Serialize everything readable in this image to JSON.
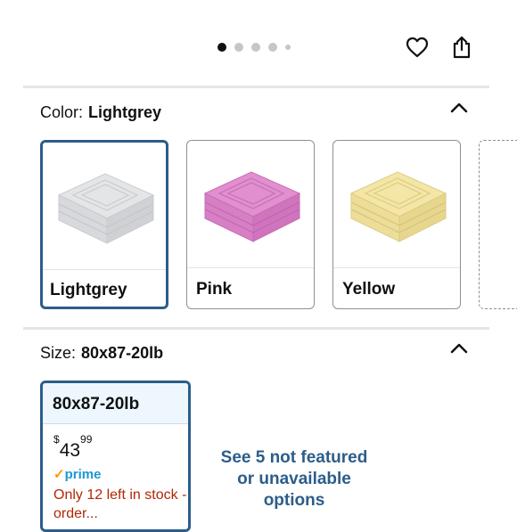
{
  "carousel": {
    "dot_count": 5,
    "active_index": 0
  },
  "header_icons": {
    "favorite": "heart-icon",
    "share": "share-icon"
  },
  "color": {
    "label": "Color:",
    "value": "Lightgrey",
    "options": [
      {
        "name": "Lightgrey",
        "color": "#e4e5e7",
        "stripe": "#c9cbce",
        "selected": true
      },
      {
        "name": "Pink",
        "color": "#e28fd0",
        "stripe": "#c66eb5",
        "selected": false
      },
      {
        "name": "Yellow",
        "color": "#f3e6a6",
        "stripe": "#ddcb82",
        "selected": false
      }
    ]
  },
  "size": {
    "label": "Size:",
    "value": "80x87-20lb",
    "option": {
      "name": "80x87-20lb",
      "currency": "$",
      "price_whole": "43",
      "price_fraction": "99",
      "prime_check": "✓",
      "prime_label": "prime",
      "stock_text": "Only 12 left in stock - order..."
    },
    "see_more": "See 5 not featured or unavailable options"
  },
  "colors": {
    "accent_blue": "#2c5d8a",
    "stock_red": "#b12704",
    "prime_blue": "#1b97d5"
  }
}
